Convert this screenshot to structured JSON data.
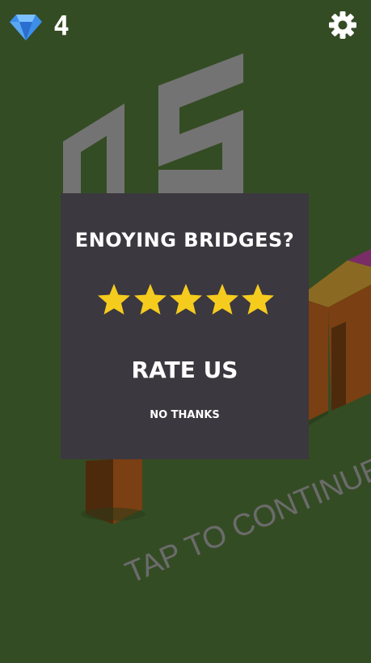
{
  "hud": {
    "gem_icon": "diamond-icon",
    "gem_count": "4",
    "settings_icon": "gear-icon"
  },
  "scene": {
    "score": "05",
    "tap_hint": "TAP TO CONTINUE"
  },
  "dialog": {
    "title": "ENOYING BRIDGES?",
    "star_icon": "star-icon",
    "rate_label": "RATE US",
    "dismiss_label": "NO THANKS"
  },
  "colors": {
    "background": "#344c24",
    "dialog": "#3b383f",
    "star": "#f5cb1e",
    "gem": "#3d8ee8",
    "pillar_front": "#7a3f12",
    "pillar_side": "#4e2a0d",
    "pillar_top": "#8a6a22",
    "accent_tile": "#7a2c66",
    "score_digits": "#737373"
  }
}
